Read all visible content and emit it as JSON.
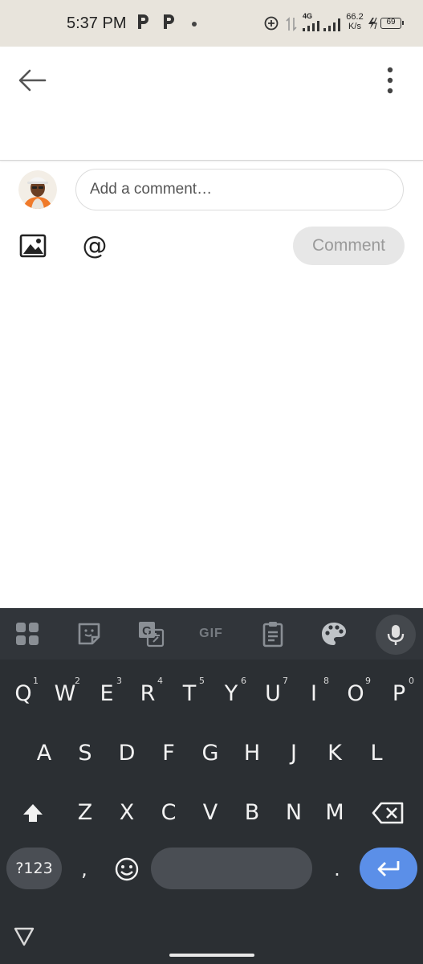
{
  "status_bar": {
    "time": "5:37 PM",
    "network_type": "4G",
    "speed_value": "66.2",
    "speed_unit": "K/s",
    "battery": "69"
  },
  "app_bar": {
    "back_icon": "arrow-back-icon",
    "more_icon": "more-vert-icon"
  },
  "comment": {
    "placeholder": "Add a comment…",
    "image_icon": "image-icon",
    "mention_symbol": "@",
    "submit_label": "Comment"
  },
  "keyboard": {
    "toolbar_icons": [
      "apps-grid-icon",
      "sticker-icon",
      "translate-icon",
      "gif-icon",
      "clipboard-icon",
      "palette-icon",
      "mic-icon"
    ],
    "gif_label": "GIF",
    "row1": [
      {
        "key": "Q",
        "hint": "1"
      },
      {
        "key": "W",
        "hint": "2"
      },
      {
        "key": "E",
        "hint": "3"
      },
      {
        "key": "R",
        "hint": "4"
      },
      {
        "key": "T",
        "hint": "5"
      },
      {
        "key": "Y",
        "hint": "6"
      },
      {
        "key": "U",
        "hint": "7"
      },
      {
        "key": "I",
        "hint": "8"
      },
      {
        "key": "O",
        "hint": "9"
      },
      {
        "key": "P",
        "hint": "0"
      }
    ],
    "row2": [
      "A",
      "S",
      "D",
      "F",
      "G",
      "H",
      "J",
      "K",
      "L"
    ],
    "row3": [
      "Z",
      "X",
      "C",
      "V",
      "B",
      "N",
      "M"
    ],
    "symbols_label": "?123",
    "comma": ",",
    "period": ".",
    "accent_color": "#5b8fe8"
  },
  "nav": {
    "back_icon": "nav-back-triangle-icon"
  }
}
